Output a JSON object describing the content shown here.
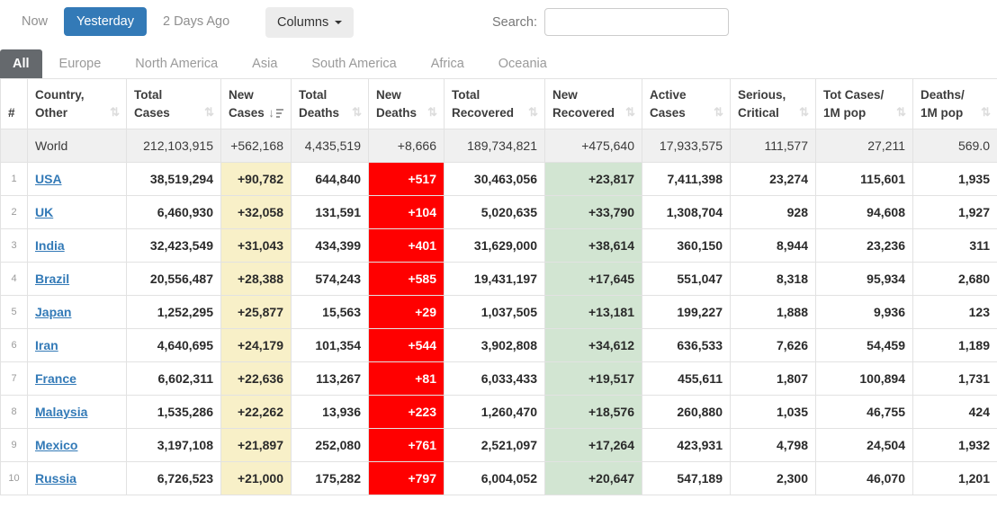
{
  "toolbar": {
    "time_filters": [
      {
        "label": "Now",
        "active": false
      },
      {
        "label": "Yesterday",
        "active": true
      },
      {
        "label": "2 Days Ago",
        "active": false
      }
    ],
    "columns_button": "Columns",
    "search_label": "Search:",
    "search_value": ""
  },
  "tabs": [
    {
      "label": "All",
      "active": true
    },
    {
      "label": "Europe",
      "active": false
    },
    {
      "label": "North America",
      "active": false
    },
    {
      "label": "Asia",
      "active": false
    },
    {
      "label": "South America",
      "active": false
    },
    {
      "label": "Africa",
      "active": false
    },
    {
      "label": "Oceania",
      "active": false
    }
  ],
  "colors": {
    "accent_blue": "#337ab7",
    "tab_active_bg": "#65696d",
    "new_cases_bg": "#F8F0C8",
    "new_deaths_bg": "#FF0000",
    "new_recovered_bg": "#D2E5D2"
  },
  "table": {
    "columns": [
      {
        "id": "rank",
        "line1": "#",
        "line2": "",
        "sortable": false,
        "sorted": ""
      },
      {
        "id": "country",
        "line1": "Country,",
        "line2": "Other",
        "sortable": true,
        "sorted": ""
      },
      {
        "id": "total_cases",
        "line1": "Total",
        "line2": "Cases",
        "sortable": true,
        "sorted": ""
      },
      {
        "id": "new_cases",
        "line1": "New",
        "line2": "Cases",
        "sortable": true,
        "sorted": "desc"
      },
      {
        "id": "total_deaths",
        "line1": "Total",
        "line2": "Deaths",
        "sortable": true,
        "sorted": ""
      },
      {
        "id": "new_deaths",
        "line1": "New",
        "line2": "Deaths",
        "sortable": true,
        "sorted": ""
      },
      {
        "id": "total_recovered",
        "line1": "Total",
        "line2": "Recovered",
        "sortable": true,
        "sorted": ""
      },
      {
        "id": "new_recovered",
        "line1": "New",
        "line2": "Recovered",
        "sortable": true,
        "sorted": ""
      },
      {
        "id": "active_cases",
        "line1": "Active",
        "line2": "Cases",
        "sortable": true,
        "sorted": ""
      },
      {
        "id": "serious_critical",
        "line1": "Serious,",
        "line2": "Critical",
        "sortable": true,
        "sorted": ""
      },
      {
        "id": "cases_per_1m",
        "line1": "Tot Cases/",
        "line2": "1M pop",
        "sortable": true,
        "sorted": ""
      },
      {
        "id": "deaths_per_1m",
        "line1": "Deaths/",
        "line2": "1M pop",
        "sortable": true,
        "sorted": ""
      }
    ],
    "world_row": {
      "rank": "",
      "country": "World",
      "total_cases": "212,103,915",
      "new_cases": "+562,168",
      "total_deaths": "4,435,519",
      "new_deaths": "+8,666",
      "total_recovered": "189,734,821",
      "new_recovered": "+475,640",
      "active_cases": "17,933,575",
      "serious_critical": "111,577",
      "cases_per_1m": "27,211",
      "deaths_per_1m": "569.0"
    },
    "rows": [
      {
        "rank": "1",
        "country": "USA",
        "total_cases": "38,519,294",
        "new_cases": "+90,782",
        "total_deaths": "644,840",
        "new_deaths": "+517",
        "total_recovered": "30,463,056",
        "new_recovered": "+23,817",
        "active_cases": "7,411,398",
        "serious_critical": "23,274",
        "cases_per_1m": "115,601",
        "deaths_per_1m": "1,935"
      },
      {
        "rank": "2",
        "country": "UK",
        "total_cases": "6,460,930",
        "new_cases": "+32,058",
        "total_deaths": "131,591",
        "new_deaths": "+104",
        "total_recovered": "5,020,635",
        "new_recovered": "+33,790",
        "active_cases": "1,308,704",
        "serious_critical": "928",
        "cases_per_1m": "94,608",
        "deaths_per_1m": "1,927"
      },
      {
        "rank": "3",
        "country": "India",
        "total_cases": "32,423,549",
        "new_cases": "+31,043",
        "total_deaths": "434,399",
        "new_deaths": "+401",
        "total_recovered": "31,629,000",
        "new_recovered": "+38,614",
        "active_cases": "360,150",
        "serious_critical": "8,944",
        "cases_per_1m": "23,236",
        "deaths_per_1m": "311"
      },
      {
        "rank": "4",
        "country": "Brazil",
        "total_cases": "20,556,487",
        "new_cases": "+28,388",
        "total_deaths": "574,243",
        "new_deaths": "+585",
        "total_recovered": "19,431,197",
        "new_recovered": "+17,645",
        "active_cases": "551,047",
        "serious_critical": "8,318",
        "cases_per_1m": "95,934",
        "deaths_per_1m": "2,680"
      },
      {
        "rank": "5",
        "country": "Japan",
        "total_cases": "1,252,295",
        "new_cases": "+25,877",
        "total_deaths": "15,563",
        "new_deaths": "+29",
        "total_recovered": "1,037,505",
        "new_recovered": "+13,181",
        "active_cases": "199,227",
        "serious_critical": "1,888",
        "cases_per_1m": "9,936",
        "deaths_per_1m": "123"
      },
      {
        "rank": "6",
        "country": "Iran",
        "total_cases": "4,640,695",
        "new_cases": "+24,179",
        "total_deaths": "101,354",
        "new_deaths": "+544",
        "total_recovered": "3,902,808",
        "new_recovered": "+34,612",
        "active_cases": "636,533",
        "serious_critical": "7,626",
        "cases_per_1m": "54,459",
        "deaths_per_1m": "1,189"
      },
      {
        "rank": "7",
        "country": "France",
        "total_cases": "6,602,311",
        "new_cases": "+22,636",
        "total_deaths": "113,267",
        "new_deaths": "+81",
        "total_recovered": "6,033,433",
        "new_recovered": "+19,517",
        "active_cases": "455,611",
        "serious_critical": "1,807",
        "cases_per_1m": "100,894",
        "deaths_per_1m": "1,731"
      },
      {
        "rank": "8",
        "country": "Malaysia",
        "total_cases": "1,535,286",
        "new_cases": "+22,262",
        "total_deaths": "13,936",
        "new_deaths": "+223",
        "total_recovered": "1,260,470",
        "new_recovered": "+18,576",
        "active_cases": "260,880",
        "serious_critical": "1,035",
        "cases_per_1m": "46,755",
        "deaths_per_1m": "424"
      },
      {
        "rank": "9",
        "country": "Mexico",
        "total_cases": "3,197,108",
        "new_cases": "+21,897",
        "total_deaths": "252,080",
        "new_deaths": "+761",
        "total_recovered": "2,521,097",
        "new_recovered": "+17,264",
        "active_cases": "423,931",
        "serious_critical": "4,798",
        "cases_per_1m": "24,504",
        "deaths_per_1m": "1,932"
      },
      {
        "rank": "10",
        "country": "Russia",
        "total_cases": "6,726,523",
        "new_cases": "+21,000",
        "total_deaths": "175,282",
        "new_deaths": "+797",
        "total_recovered": "6,004,052",
        "new_recovered": "+20,647",
        "active_cases": "547,189",
        "serious_critical": "2,300",
        "cases_per_1m": "46,070",
        "deaths_per_1m": "1,201"
      }
    ]
  }
}
